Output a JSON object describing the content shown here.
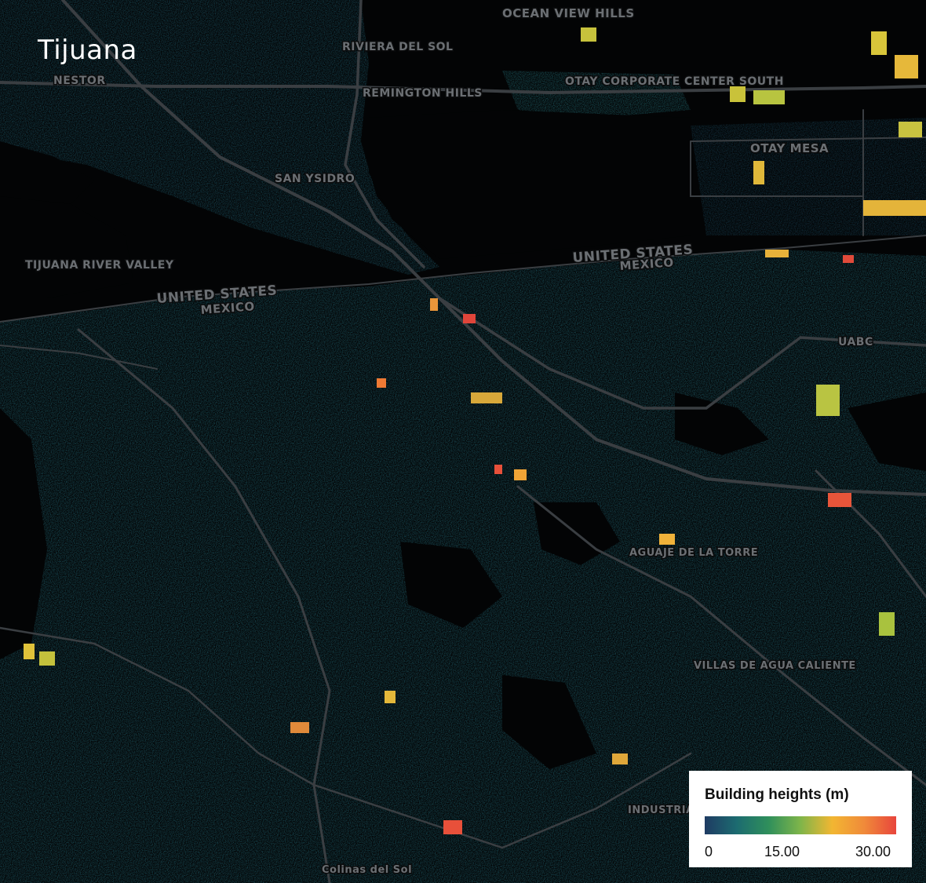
{
  "map": {
    "title": "Tijuana",
    "place_labels": [
      "OCEAN VIEW HILLS",
      "RIVIERA DEL SOL",
      "NESTOR",
      "REMINGTON HILLS",
      "OTAY CORPORATE CENTER SOUTH",
      "OTAY MESA",
      "SAN YSIDRO",
      "TIJUANA RIVER VALLEY",
      "UNITED STATES",
      "MEXICO",
      "UNITED STATES",
      "MEXICO",
      "UABC",
      "AGUAJE DE LA TORRE",
      "INDUSTRIAL PACIFICO",
      "VILLAS DE AGUA CALIENTE",
      "Colinas del Sol"
    ],
    "colors": {
      "background": "#030405",
      "road": "#3a3e42",
      "low": "#1f3f5f",
      "mid": "#2f8a6a",
      "high": "#f4b13a",
      "max": "#e8453c"
    }
  },
  "legend": {
    "title": "Building heights (m)",
    "ticks": [
      "0",
      "15.00",
      "30.00"
    ],
    "gradient": [
      "#1f3b63",
      "#1c6b70",
      "#2f8f5b",
      "#7fb54a",
      "#f2b632",
      "#f08a3a",
      "#e8453c"
    ]
  }
}
